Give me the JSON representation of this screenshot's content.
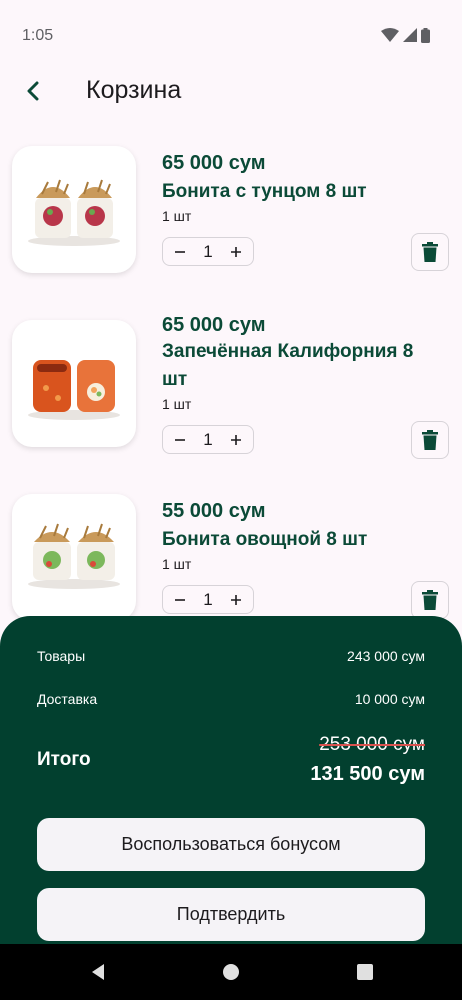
{
  "status_bar": {
    "time": "1:05",
    "icons": [
      "wifi-icon",
      "signal-icon",
      "battery-icon"
    ]
  },
  "app_bar": {
    "title": "Корзина",
    "back_icon": "chevron-left-icon"
  },
  "items": [
    {
      "price": "65 000 сум",
      "name": "Бонита с тунцом 8 шт",
      "unit": "1 шт",
      "quantity": "1"
    },
    {
      "price": "65 000 сум",
      "name": "Запечённая Калифорния 8 шт",
      "unit": "1 шт",
      "quantity": "1"
    },
    {
      "price": "55 000 сум",
      "name": "Бонита овощной 8 шт",
      "unit": "1 шт",
      "quantity": "1"
    }
  ],
  "summary": {
    "goods_label": "Товары",
    "goods_value": "243 000 сум",
    "delivery_label": "Доставка",
    "delivery_value": "10 000 сум",
    "total_label": "Итого",
    "old_total": "253 000 сум",
    "new_total": "131 500 сум",
    "bonus_button": "Воспользоваться бонусом",
    "confirm_button": "Подтвердить"
  },
  "colors": {
    "accent": "#0b4a37",
    "summary_bg": "#02402f",
    "background": "#fdf7fb",
    "strike": "#d9534f"
  }
}
